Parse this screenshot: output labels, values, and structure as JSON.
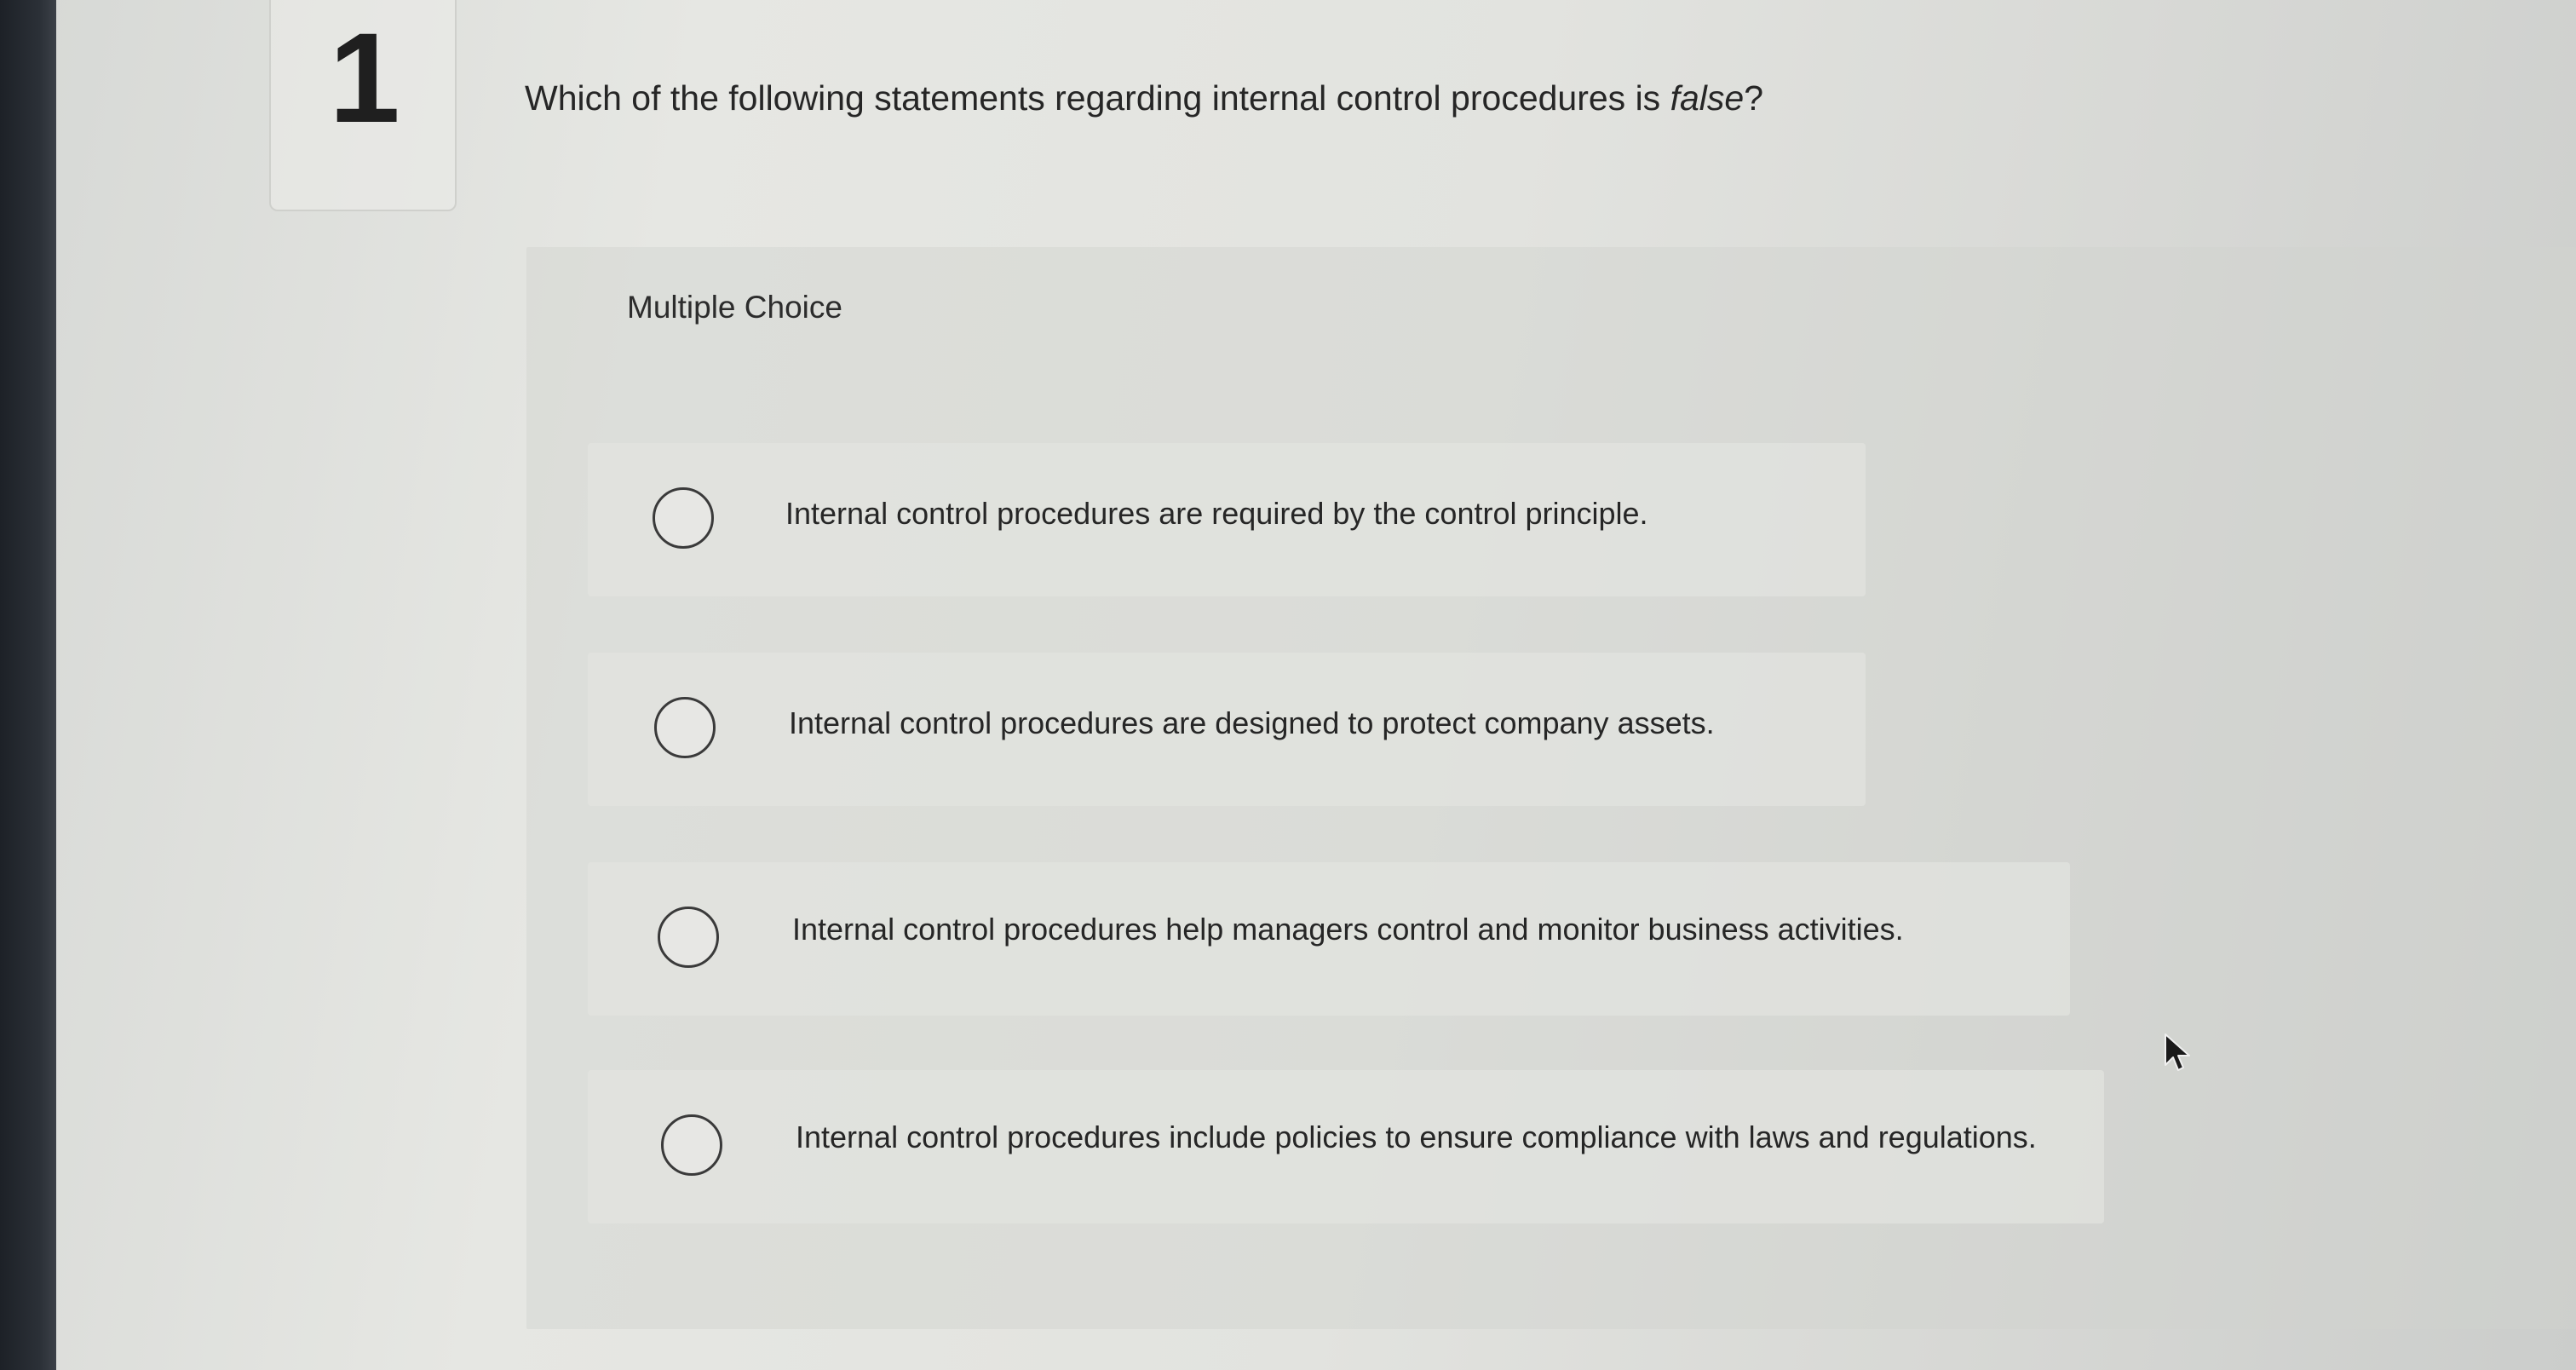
{
  "question": {
    "number": "1",
    "prompt_start": "Which of the following statements regarding internal control procedures is ",
    "prompt_emphasis": "false",
    "prompt_end": "?"
  },
  "answer_section": {
    "type_label": "Multiple Choice",
    "options": [
      {
        "label": "Internal control procedures are required by the control principle."
      },
      {
        "label": "Internal control procedures are designed to protect company assets."
      },
      {
        "label": "Internal control procedures help managers control and monitor business activities."
      },
      {
        "label": "Internal control procedures include policies to ensure compliance with laws and regulations."
      }
    ]
  },
  "icons": {
    "radio": "radio-button-icon",
    "cursor": "mouse-pointer-icon"
  }
}
